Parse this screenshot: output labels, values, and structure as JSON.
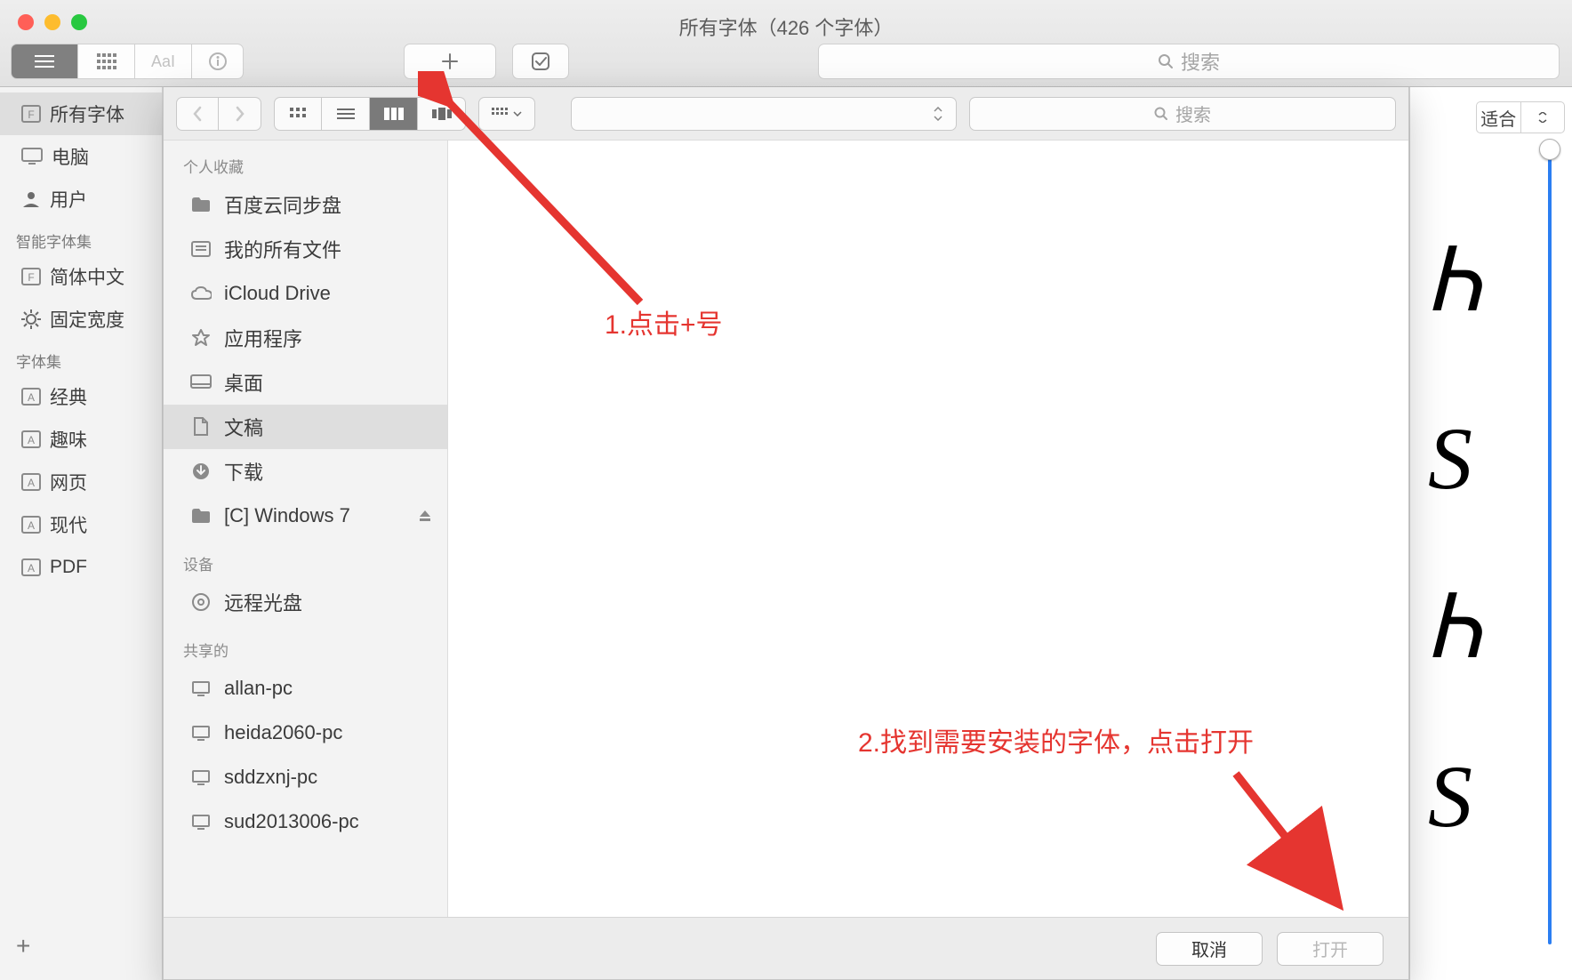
{
  "window": {
    "title": "所有字体（426 个字体）"
  },
  "toolbar": {
    "sample_text": "AaI",
    "search_placeholder": "搜索"
  },
  "fb_sidebar": {
    "collections": [
      {
        "label": "所有字体",
        "selected": true,
        "name": "sidebar-item-all-fonts"
      },
      {
        "label": "电脑",
        "selected": false,
        "name": "sidebar-item-computer"
      },
      {
        "label": "用户",
        "selected": false,
        "name": "sidebar-item-user"
      }
    ],
    "smart_heading": "智能字体集",
    "smart": [
      {
        "label": "简体中文",
        "name": "sidebar-item-simplified-chinese"
      },
      {
        "label": "固定宽度",
        "name": "sidebar-item-fixed-width"
      }
    ],
    "sets_heading": "字体集",
    "sets": [
      {
        "label": "经典",
        "name": "sidebar-item-classic"
      },
      {
        "label": "趣味",
        "name": "sidebar-item-fun"
      },
      {
        "label": "网页",
        "name": "sidebar-item-web"
      },
      {
        "label": "现代",
        "name": "sidebar-item-modern"
      },
      {
        "label": "PDF",
        "name": "sidebar-item-pdf"
      }
    ]
  },
  "preview": {
    "fit_label": "适合",
    "letters": [
      "Ꮒ",
      "S",
      "Ꮒ",
      "S"
    ]
  },
  "sheet": {
    "search_placeholder": "搜索",
    "sidebar": {
      "favorites_heading": "个人收藏",
      "favorites": [
        {
          "label": "百度云同步盘",
          "icon": "folder",
          "name": "finder-fav-baidu"
        },
        {
          "label": "我的所有文件",
          "icon": "allfiles",
          "name": "finder-fav-allfiles"
        },
        {
          "label": "iCloud Drive",
          "icon": "cloud",
          "name": "finder-fav-icloud"
        },
        {
          "label": "应用程序",
          "icon": "apps",
          "name": "finder-fav-applications"
        },
        {
          "label": "桌面",
          "icon": "desktop",
          "name": "finder-fav-desktop"
        },
        {
          "label": "文稿",
          "icon": "documents",
          "name": "finder-fav-documents",
          "selected": true
        },
        {
          "label": "下载",
          "icon": "downloads",
          "name": "finder-fav-downloads"
        },
        {
          "label": "[C] Windows 7",
          "icon": "folder",
          "name": "finder-fav-windows7",
          "eject": true
        }
      ],
      "devices_heading": "设备",
      "devices": [
        {
          "label": "远程光盘",
          "icon": "disc",
          "name": "finder-dev-remote-disc"
        }
      ],
      "shared_heading": "共享的",
      "shared": [
        {
          "label": "allan-pc",
          "icon": "pc",
          "name": "finder-shared-allan-pc"
        },
        {
          "label": "heida2060-pc",
          "icon": "pc",
          "name": "finder-shared-heida2060-pc"
        },
        {
          "label": "sddzxnj-pc",
          "icon": "pc",
          "name": "finder-shared-sddzxnj-pc"
        },
        {
          "label": "sud2013006-pc",
          "icon": "pc",
          "name": "finder-shared-sud2013006-pc"
        }
      ]
    },
    "buttons": {
      "cancel": "取消",
      "open": "打开"
    }
  },
  "annotations": {
    "step1": "1.点击+号",
    "step2": "2.找到需要安装的字体，点击打开"
  }
}
